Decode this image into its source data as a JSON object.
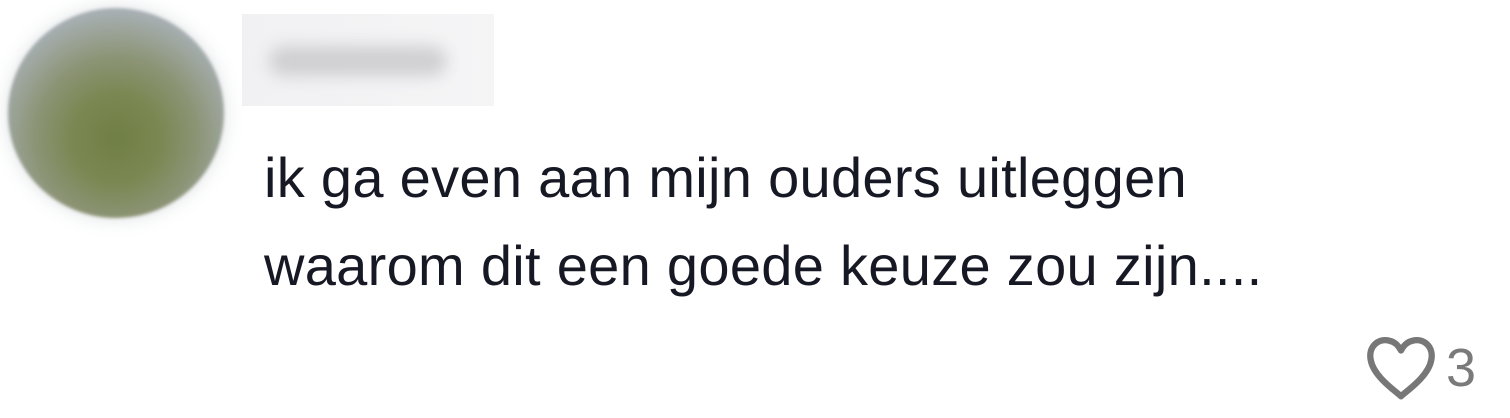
{
  "comment": {
    "text": "ik ga even aan mijn ouders uitleggen\nwaarom dit een goede keuze zou zijn....",
    "like_count": "3"
  },
  "icons": {
    "like": "heart-outline-icon"
  },
  "colors": {
    "text": "#161824",
    "muted": "#777777",
    "background": "#ffffff"
  }
}
